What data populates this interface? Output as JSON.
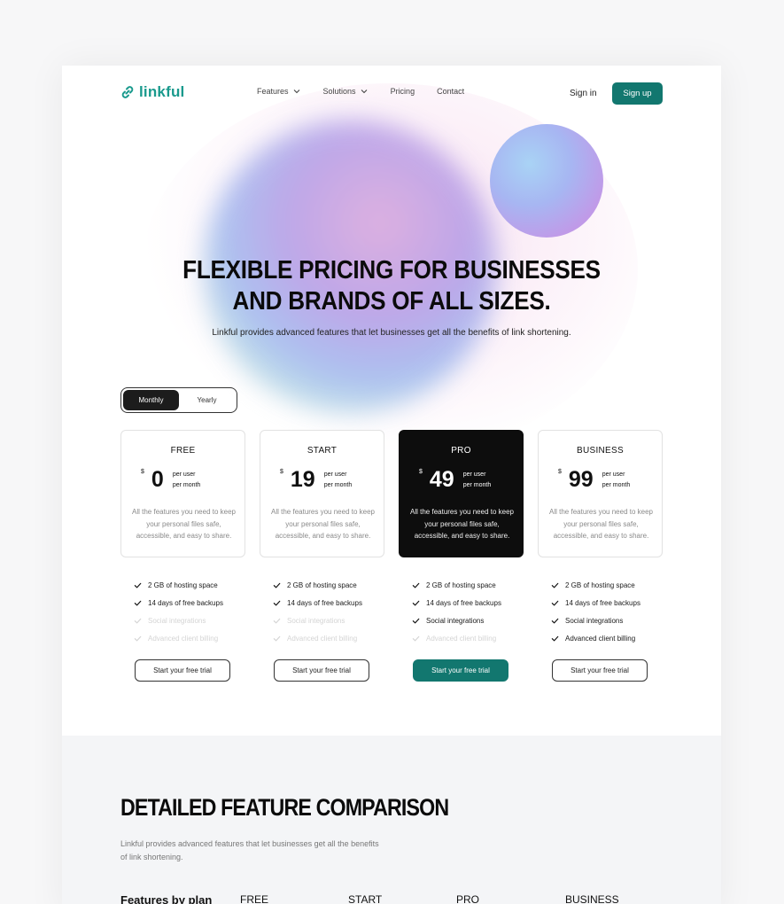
{
  "brand": {
    "name": "linkful",
    "accent": "#12776f",
    "logo_color": "#1a9a8d"
  },
  "nav": {
    "links": [
      {
        "label": "Features",
        "has_dropdown": true
      },
      {
        "label": "Solutions",
        "has_dropdown": true
      },
      {
        "label": "Pricing",
        "has_dropdown": false
      },
      {
        "label": "Contact",
        "has_dropdown": false
      }
    ],
    "signin_label": "Sign in",
    "signup_label": "Sign up"
  },
  "hero": {
    "title_line1": "FLEXIBLE PRICING FOR BUSINESSES",
    "title_line2": "AND BRANDS OF ALL SIZES.",
    "subtitle": "Linkful provides advanced features that let businesses get all the benefits of link shortening."
  },
  "billing_toggle": {
    "options": [
      "Monthly",
      "Yearly"
    ],
    "selected": "Monthly"
  },
  "plans": [
    {
      "name": "FREE",
      "currency": "$",
      "price": "0",
      "per_line1": "per user",
      "per_line2": "per month",
      "description": "All the features you need to keep your personal files safe, accessible, and easy to share.",
      "features": [
        {
          "label": "2 GB of hosting space",
          "included": true
        },
        {
          "label": "14 days of free backups",
          "included": true
        },
        {
          "label": "Social integrations",
          "included": false
        },
        {
          "label": "Advanced client billing",
          "included": false
        }
      ],
      "cta": "Start your free trial",
      "highlight": false
    },
    {
      "name": "START",
      "currency": "$",
      "price": "19",
      "per_line1": "per user",
      "per_line2": "per month",
      "description": "All the features you need to keep your personal files safe, accessible, and easy to share.",
      "features": [
        {
          "label": "2 GB of hosting space",
          "included": true
        },
        {
          "label": "14 days of free backups",
          "included": true
        },
        {
          "label": "Social integrations",
          "included": false
        },
        {
          "label": "Advanced client billing",
          "included": false
        }
      ],
      "cta": "Start your free trial",
      "highlight": false
    },
    {
      "name": "PRO",
      "currency": "$",
      "price": "49",
      "per_line1": "per user",
      "per_line2": "per month",
      "description": "All the features you need to keep your personal files safe, accessible, and easy to share.",
      "features": [
        {
          "label": "2 GB of hosting space",
          "included": true
        },
        {
          "label": "14 days of free backups",
          "included": true
        },
        {
          "label": "Social integrations",
          "included": true
        },
        {
          "label": "Advanced client billing",
          "included": false
        }
      ],
      "cta": "Start your free trial",
      "highlight": true
    },
    {
      "name": "BUSINESS",
      "currency": "$",
      "price": "99",
      "per_line1": "per user",
      "per_line2": "per month",
      "description": "All the features you need to keep your personal files safe, accessible, and easy to share.",
      "features": [
        {
          "label": "2 GB of hosting space",
          "included": true
        },
        {
          "label": "14 days of free backups",
          "included": true
        },
        {
          "label": "Social integrations",
          "included": true
        },
        {
          "label": "Advanced client billing",
          "included": true
        }
      ],
      "cta": "Start your free trial",
      "highlight": false
    }
  ],
  "comparison": {
    "title": "DETAILED FEATURE COMPARISON",
    "subtitle": "Linkful provides advanced features that let businesses get all the benefits of link shortening.",
    "headers": [
      "Features by plan",
      "FREE",
      "START",
      "PRO",
      "BUSINESS"
    ]
  }
}
